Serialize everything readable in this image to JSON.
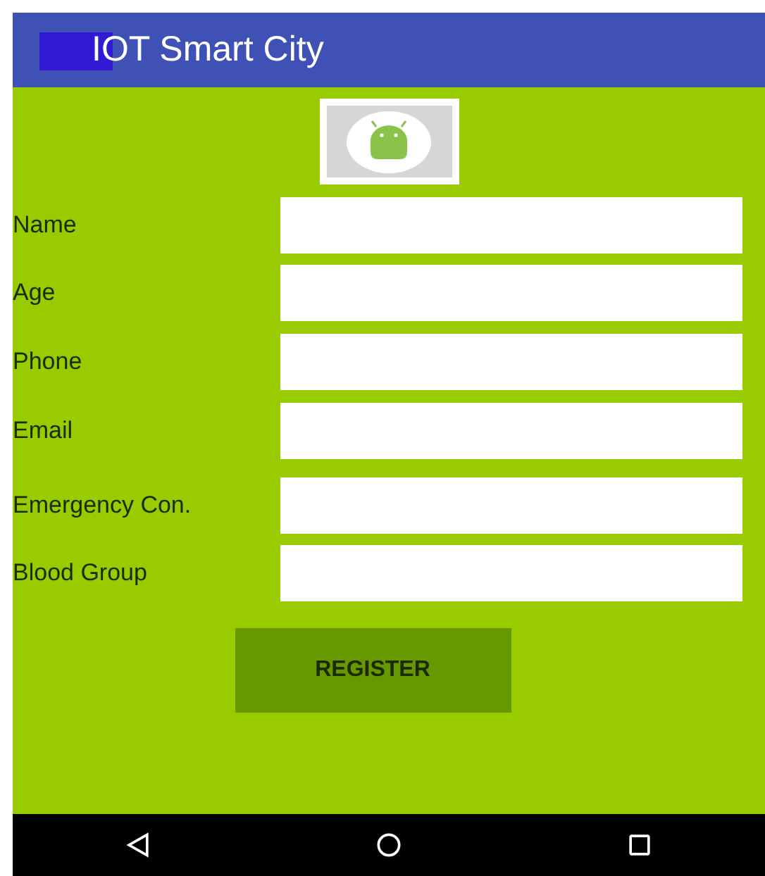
{
  "app_bar": {
    "title": "IOT Smart City"
  },
  "form": {
    "fields": [
      {
        "label": "Name"
      },
      {
        "label": "Age"
      },
      {
        "label": "Phone"
      },
      {
        "label": "Email"
      },
      {
        "label": "Emergency Con."
      },
      {
        "label": "Blood Group"
      }
    ]
  },
  "register_button": {
    "label": "REGISTER"
  }
}
